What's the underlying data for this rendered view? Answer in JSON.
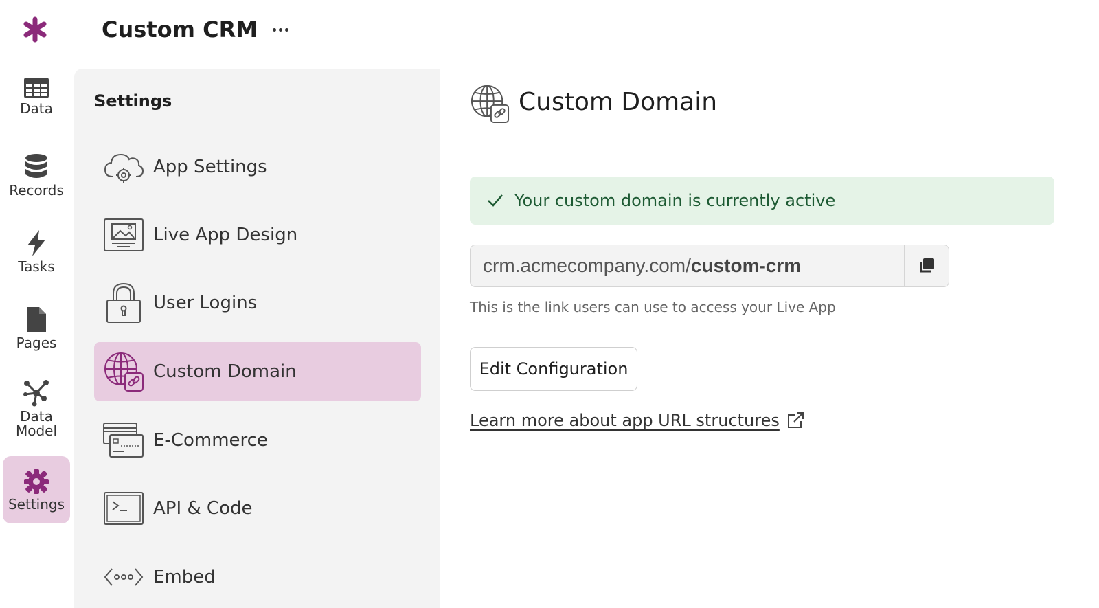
{
  "header": {
    "app_title": "Custom CRM",
    "logo_icon": "asterisk-logo-icon",
    "more_icon": "more-horizontal-icon",
    "brand_color": "#8b2a7a"
  },
  "rail": {
    "items": [
      {
        "label": "Data",
        "icon": "table-icon"
      },
      {
        "label": "Records",
        "icon": "database-icon"
      },
      {
        "label": "Tasks",
        "icon": "lightning-icon"
      },
      {
        "label": "Pages",
        "icon": "page-icon"
      },
      {
        "label": "Data\nModel",
        "icon": "network-icon"
      },
      {
        "label": "Settings",
        "icon": "gear-icon",
        "active": true
      }
    ],
    "active_bg": "#e8cce0"
  },
  "settings": {
    "title": "Settings",
    "items": [
      {
        "label": "App Settings",
        "icon": "cloud-gear-icon"
      },
      {
        "label": "Live App Design",
        "icon": "monitor-image-icon"
      },
      {
        "label": "User Logins",
        "icon": "padlock-icon"
      },
      {
        "label": "Custom Domain",
        "icon": "globe-link-icon",
        "active": true
      },
      {
        "label": "E-Commerce",
        "icon": "credit-card-icon"
      },
      {
        "label": "API & Code",
        "icon": "terminal-icon"
      },
      {
        "label": "Embed",
        "icon": "embed-code-icon"
      }
    ]
  },
  "main": {
    "title": "Custom Domain",
    "title_icon": "globe-link-icon",
    "status": {
      "text": "Your custom domain is currently active",
      "icon": "check-icon",
      "bg_color": "#e5f3e7",
      "text_color": "#1d5a33"
    },
    "url": {
      "domain": "crm.acmecompany.com/",
      "path": "custom-crm",
      "copy_icon": "copy-icon"
    },
    "url_help": "This is the link users can use to access your Live App",
    "edit_button": "Edit Configuration",
    "learn_more": {
      "text": "Learn more about app URL structures",
      "icon": "external-link-icon"
    }
  }
}
